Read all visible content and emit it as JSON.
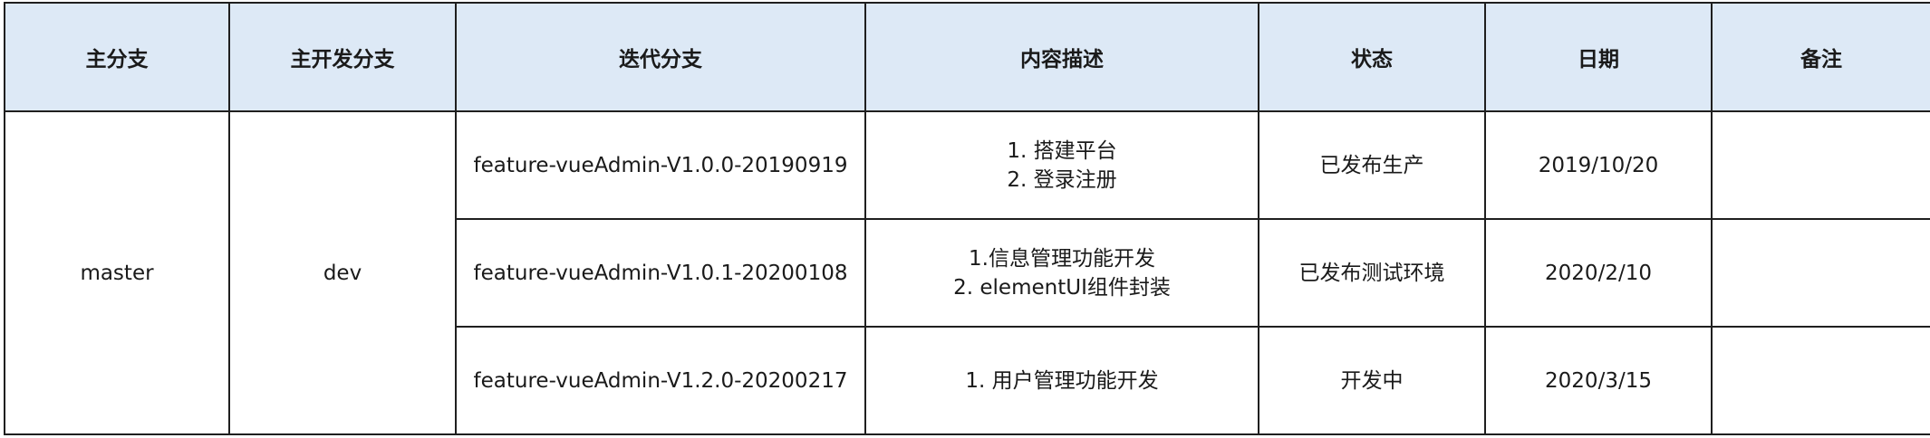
{
  "table": {
    "headers": [
      "主分支",
      "主开发分支",
      "迭代分支",
      "内容描述",
      "状态",
      "日期",
      "备注"
    ],
    "main_branch": "master",
    "dev_branch": "dev",
    "rows": [
      {
        "iteration": "feature-vueAdmin-V1.0.0-20190919",
        "description": [
          "1. 搭建平台",
          "2. 登录注册"
        ],
        "status": "已发布生产",
        "date": "2019/10/20",
        "note": ""
      },
      {
        "iteration": "feature-vueAdmin-V1.0.1-20200108",
        "description": [
          "1.信息管理功能开发",
          "2. elementUI组件封装"
        ],
        "status": "已发布测试环境",
        "date": "2020/2/10",
        "note": ""
      },
      {
        "iteration": "feature-vueAdmin-V1.2.0-20200217",
        "description": [
          "1. 用户管理功能开发"
        ],
        "status": "开发中",
        "date": "2020/3/15",
        "note": ""
      }
    ]
  },
  "colors": {
    "header_background": "#dde9f6",
    "border": "#1f1f1f",
    "text": "#1a1a1a"
  }
}
